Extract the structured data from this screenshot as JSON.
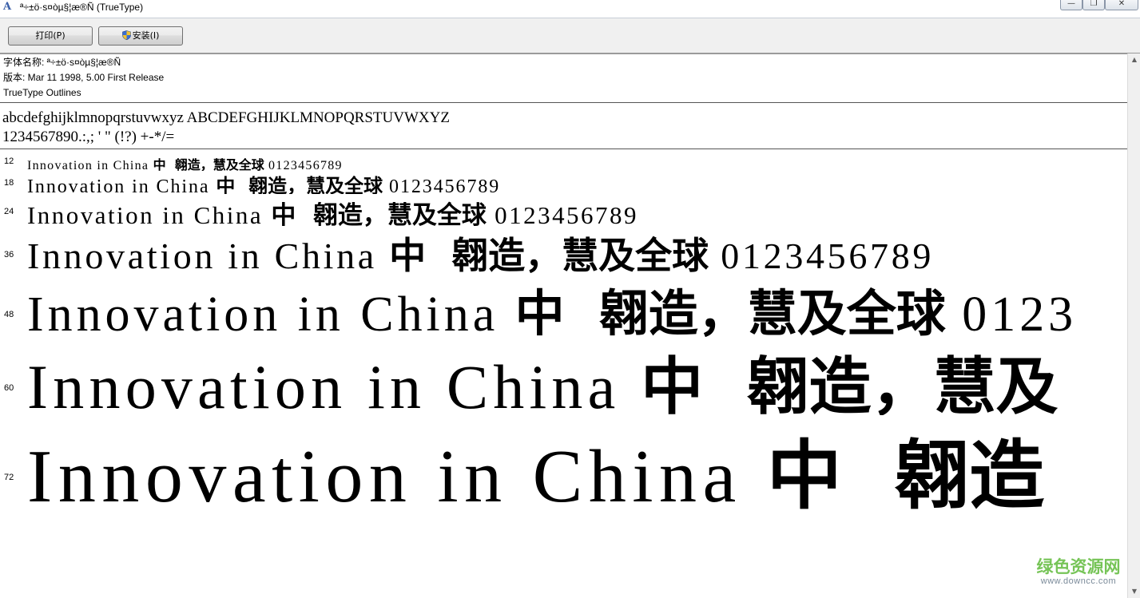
{
  "window": {
    "title": "ª÷±ö·s¤òµ§¦æ®Ñ (TrueType)",
    "app_icon": "A",
    "minimize_glyph": "—",
    "restore_glyph": "❐",
    "close_glyph": "✕"
  },
  "toolbar": {
    "print_label": "打印(P)",
    "install_label": "安装(I)"
  },
  "info": {
    "font_name": "字体名称: ª÷±ö·s¤òµ§¦æ®Ñ",
    "version": "版本: Mar 11 1998, 5.00 First Release",
    "outlines": "TrueType Outlines"
  },
  "charset": {
    "line1": "abcdefghijklmnopqrstuvwxyz ABCDEFGHIJKLMNOPQRSTUVWXYZ",
    "line2": "1234567890.:,; ' \" (!?) +-*/="
  },
  "samples": [
    {
      "size": "12",
      "latin": "Innovation in China ",
      "cjk": "中  翱造，慧及全球",
      "digits": " 0123456789"
    },
    {
      "size": "18",
      "latin": "Innovation in China ",
      "cjk": "中  翱造，慧及全球",
      "digits": " 0123456789"
    },
    {
      "size": "24",
      "latin": "Innovation in China ",
      "cjk": "中  翱造，慧及全球",
      "digits": " 0123456789"
    },
    {
      "size": "36",
      "latin": "Innovation in China ",
      "cjk": "中  翱造，慧及全球",
      "digits": " 0123456789"
    },
    {
      "size": "48",
      "latin": "Innovation in China ",
      "cjk": "中  翱造，慧及全球",
      "digits": " 0123"
    },
    {
      "size": "60",
      "latin": "Innovation in China ",
      "cjk": "中  翱造，慧及",
      "digits": ""
    },
    {
      "size": "72",
      "latin": "Innovation in China ",
      "cjk": "中  翱造",
      "digits": ""
    }
  ],
  "watermark": {
    "main": "绿色资源网",
    "sub": "www.downcc.com"
  },
  "scrollbar": {
    "up_glyph": "▲",
    "down_glyph": "▼"
  }
}
